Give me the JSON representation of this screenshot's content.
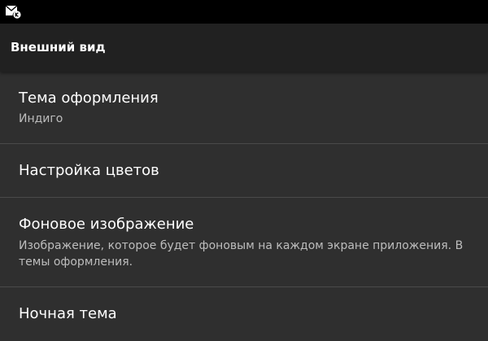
{
  "status_bar": {
    "notification_icon": "mail-k-icon"
  },
  "app_bar": {
    "title": "Внешний вид"
  },
  "preferences": [
    {
      "title": "Тема оформления",
      "summary": "Индиго"
    },
    {
      "title": "Настройка цветов"
    },
    {
      "title": "Фоновое изображение",
      "summary_line1": "Изображение, которое будет фоновым на каждом экране приложения. В",
      "summary_line2": "темы оформления."
    },
    {
      "title": "Ночная тема"
    }
  ],
  "colors": {
    "status_bar": "#000000",
    "app_bar": "#212121",
    "background": "#2f2f2f",
    "divider": "#4a4a4a",
    "title_text": "#ffffff",
    "summary_text": "#bdbdbd"
  }
}
